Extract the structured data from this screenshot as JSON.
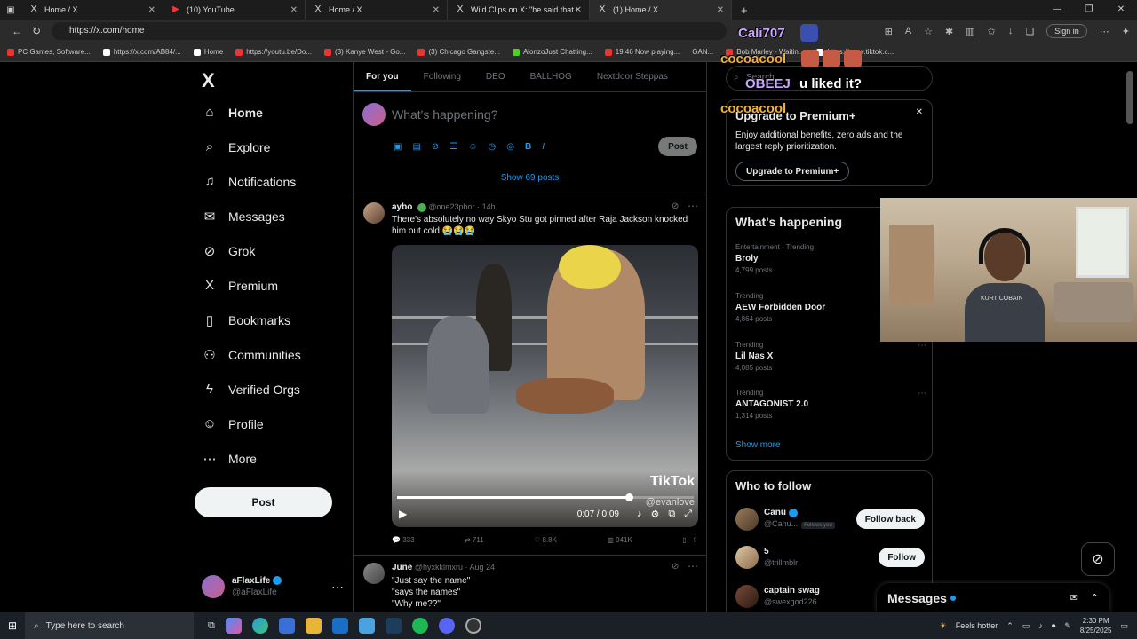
{
  "browser": {
    "tabs": [
      {
        "icon": "x-logo-icon",
        "title": "Home / X"
      },
      {
        "icon": "youtube-icon",
        "title": "(10) YouTube"
      },
      {
        "icon": "x-logo-icon",
        "title": "Home / X"
      },
      {
        "icon": "x-logo-icon",
        "title": "Wild Clips on X: \"he said that shi"
      },
      {
        "icon": "x-logo-icon",
        "title": "(1) Home / X"
      }
    ],
    "new_tab": "+",
    "url": "https://x.com/home",
    "sign_in": "Sign in",
    "bookmarks": [
      "PC Games, Software...",
      "https://x.com/AB84/...",
      "Home",
      "https://youtu.be/Do...",
      "(3) Kanye West - Go...",
      "(3) Chicago Gangste...",
      "AlonzoJust Chatting...",
      "19:46 Now playing...",
      "GAN...",
      "Bob Marley - Waitin...",
      "https://www.tiktok.c..."
    ]
  },
  "sidebar": {
    "logo": "X",
    "items": [
      {
        "label": "Home",
        "icon": "home-icon",
        "glyph": "⌂"
      },
      {
        "label": "Explore",
        "icon": "search-icon",
        "glyph": "⌕"
      },
      {
        "label": "Notifications",
        "icon": "bell-icon",
        "glyph": "♫"
      },
      {
        "label": "Messages",
        "icon": "mail-icon",
        "glyph": "✉"
      },
      {
        "label": "Grok",
        "icon": "grok-icon",
        "glyph": "⊘"
      },
      {
        "label": "Premium",
        "icon": "x-logo-icon",
        "glyph": "X"
      },
      {
        "label": "Bookmarks",
        "icon": "bookmark-icon",
        "glyph": "▯"
      },
      {
        "label": "Communities",
        "icon": "communities-icon",
        "glyph": "⚇"
      },
      {
        "label": "Verified Orgs",
        "icon": "lightning-icon",
        "glyph": "ϟ"
      },
      {
        "label": "Profile",
        "icon": "person-icon",
        "glyph": "☺"
      },
      {
        "label": "More",
        "icon": "more-circle-icon",
        "glyph": "⋯"
      }
    ],
    "post_label": "Post",
    "account": {
      "name": "aFlaxLife",
      "handle": "@aFlaxLife"
    }
  },
  "feed": {
    "tabs": [
      "For you",
      "Following",
      "DEO",
      "BALLHOG",
      "Nextdoor Steppas"
    ],
    "compose_placeholder": "What's happening?",
    "compose_post": "Post",
    "show_posts": "Show 69 posts",
    "tweet1": {
      "name": "aybo",
      "handle": "@one23phor",
      "time": "14h",
      "text": "There's absolutely no way Skyo Stu got pinned after Raja Jackson knocked him out cold 😭😭😭",
      "watermark": "TikTok",
      "watermark_handle": "@evanlove",
      "time_display": "0:07 / 0:09",
      "progress": 0.78,
      "replies": "333",
      "reposts": "711",
      "likes": "8.8K",
      "views": "941K"
    },
    "tweet2": {
      "name": "June",
      "handle": "@hyxkklmxru",
      "time": "Aug 24",
      "lines": [
        "\"Just say the name\"",
        "\"says the names\"",
        "\"Why me??\""
      ]
    }
  },
  "right": {
    "search_placeholder": "Search",
    "premium": {
      "title": "Upgrade to Premium+",
      "text": "Enjoy additional benefits, zero ads and the largest reply prioritization.",
      "button": "Upgrade to Premium+"
    },
    "whats_happening": {
      "title": "What's happening",
      "trends": [
        {
          "category": "Entertainment · Trending",
          "name": "Broly",
          "count": "4,799 posts"
        },
        {
          "category": "Trending",
          "name": "AEW Forbidden Door",
          "count": "4,864 posts"
        },
        {
          "category": "Trending",
          "name": "Lil Nas X",
          "count": "4,085 posts"
        },
        {
          "category": "Trending",
          "name": "ANTAGONIST 2.0",
          "count": "1,314 posts"
        }
      ],
      "show_more": "Show more"
    },
    "who_to_follow": {
      "title": "Who to follow",
      "people": [
        {
          "name": "Canu",
          "handle": "@Canu...",
          "badge": "Follows you",
          "button": "Follow back"
        },
        {
          "name": "5",
          "handle": "@trillmblr",
          "badge": "",
          "button": "Follow"
        },
        {
          "name": "captain swag",
          "handle": "@swexgod226",
          "badge": "",
          "button": ""
        }
      ]
    }
  },
  "messages_dock": {
    "title": "Messages"
  },
  "webcam": {
    "shirt_text": "KURT COBAIN"
  },
  "overlay": {
    "chat": [
      {
        "text": "Cali707",
        "color": "#c9a6ff"
      },
      {
        "text": "cocoacool",
        "color": "#f0b23a"
      },
      {
        "text": "OBEEJ",
        "color": "#c9a6ff"
      },
      {
        "text": "u liked it?",
        "color": "#ffffff"
      },
      {
        "text": "cocoacool",
        "color": "#f0b23a"
      }
    ]
  },
  "taskbar": {
    "search_placeholder": "Type here to search",
    "weather": "Feels hotter",
    "time": "2:30 PM",
    "date": "8/25/2025"
  }
}
